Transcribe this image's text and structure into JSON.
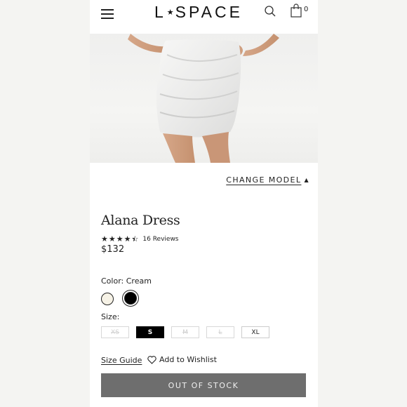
{
  "header": {
    "logo": {
      "left": "L",
      "right": "SPACE",
      "star": "★"
    },
    "cart_count": "0",
    "icons": {
      "menu": "hamburger-menu-icon",
      "search": "search-icon",
      "bag": "shopping-bag-icon"
    }
  },
  "gallery": {
    "image_count": 9,
    "active_index": 1
  },
  "change_model": {
    "label": "CHANGE MODEL",
    "caret": "▲"
  },
  "product": {
    "title": "Alana Dress",
    "rating": 4.5,
    "reviews": "16 Reviews",
    "price": "$132"
  },
  "color": {
    "label": "Color: Cream",
    "options": [
      {
        "name": "Cream",
        "hex": "#f6f2e6"
      },
      {
        "name": "Black",
        "hex": "#000000"
      }
    ]
  },
  "size": {
    "label": "Size:",
    "options": [
      {
        "label": "XS",
        "available": false,
        "selected": false
      },
      {
        "label": "S",
        "available": true,
        "selected": true
      },
      {
        "label": "M",
        "available": false,
        "selected": false
      },
      {
        "label": "L",
        "available": false,
        "selected": false
      },
      {
        "label": "XL",
        "available": true,
        "selected": false
      }
    ]
  },
  "links": {
    "size_guide": "Size Guide",
    "wishlist": "Add to Wishlist"
  },
  "cta": {
    "label": "OUT OF STOCK"
  },
  "colors": {
    "button_bg": "#6e6e6e",
    "selected_size_bg": "#000000"
  }
}
